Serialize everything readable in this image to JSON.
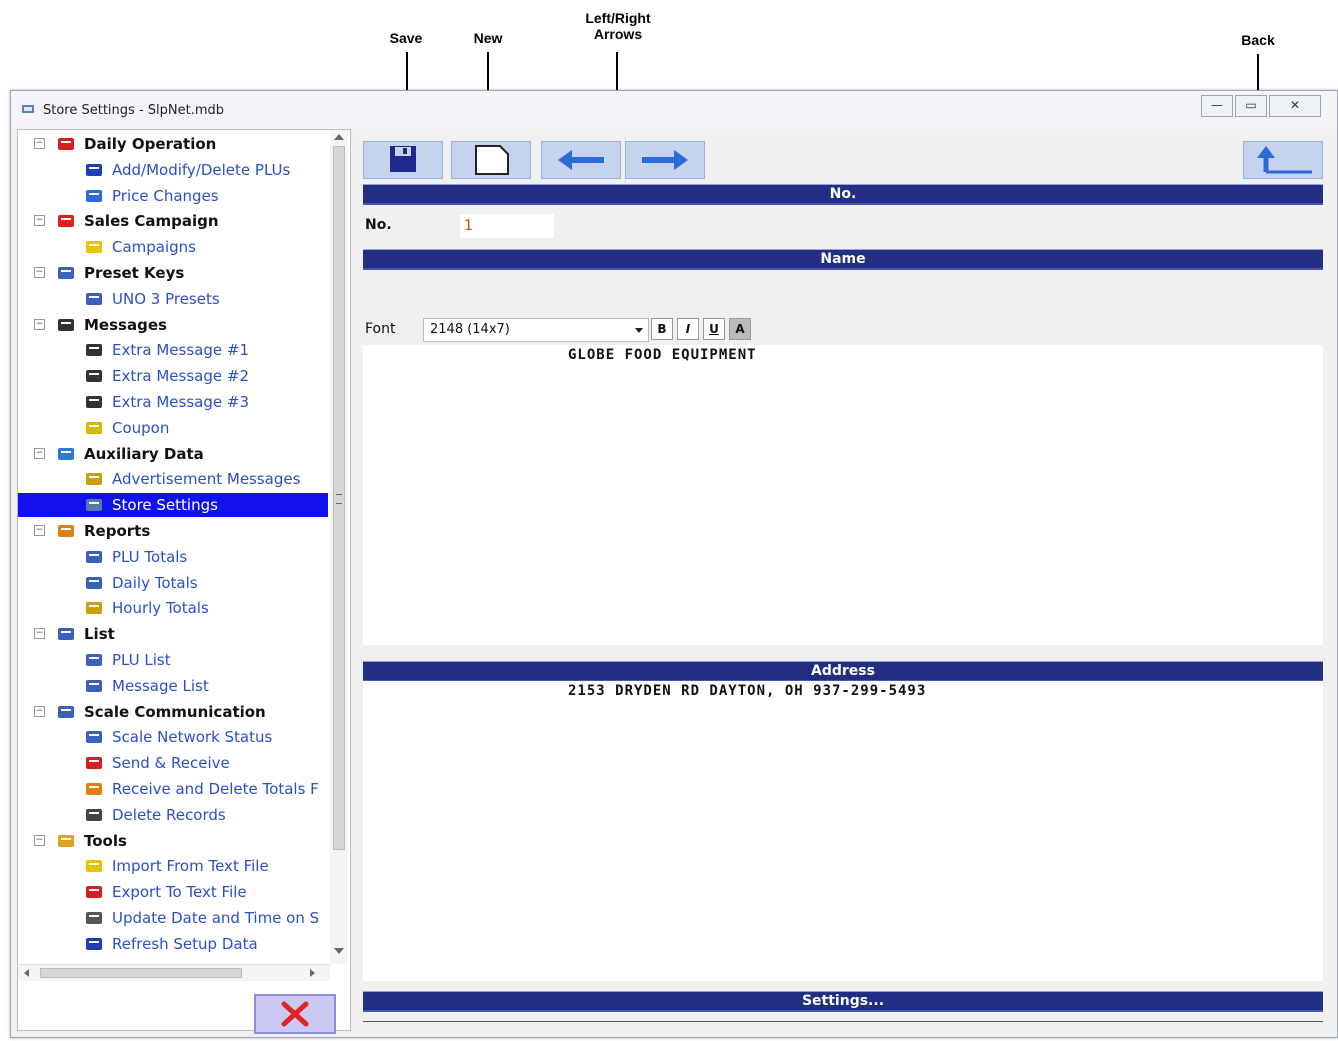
{
  "callouts": {
    "save": "Save",
    "new": "New",
    "arrows_line1": "Left/Right",
    "arrows_line2": "Arrows",
    "back": "Back"
  },
  "window": {
    "title": "Store Settings - SlpNet.mdb",
    "minimize": "—",
    "maximize": "▭",
    "close": "✕"
  },
  "tree": [
    {
      "type": "category",
      "label": "Daily Operation",
      "icon": "daily-operation-icon",
      "expander": "−"
    },
    {
      "type": "item",
      "label": "Add/Modify/Delete PLUs",
      "icon": "plu-icon"
    },
    {
      "type": "item",
      "label": "Price Changes",
      "icon": "price-changes-icon"
    },
    {
      "type": "category",
      "label": "Sales Campaign",
      "icon": "star-icon",
      "expander": "−"
    },
    {
      "type": "item",
      "label": "Campaigns",
      "icon": "campaign-star-icon"
    },
    {
      "type": "category",
      "label": "Preset Keys",
      "icon": "preset-keys-icon",
      "expander": "−"
    },
    {
      "type": "item",
      "label": "UNO 3 Presets",
      "icon": "presets-icon"
    },
    {
      "type": "category",
      "label": "Messages",
      "icon": "messages-icon",
      "expander": "−"
    },
    {
      "type": "item",
      "label": "Extra Message #1",
      "icon": "message-icon"
    },
    {
      "type": "item",
      "label": "Extra Message #2",
      "icon": "message-icon"
    },
    {
      "type": "item",
      "label": "Extra Message #3",
      "icon": "message-icon"
    },
    {
      "type": "item",
      "label": "Coupon",
      "icon": "coupon-icon"
    },
    {
      "type": "category",
      "label": "Auxiliary Data",
      "icon": "auxiliary-star-icon",
      "expander": "−"
    },
    {
      "type": "item",
      "label": "Advertisement Messages",
      "icon": "advertisement-icon"
    },
    {
      "type": "item",
      "label": "Store Settings",
      "icon": "store-icon",
      "selected": true
    },
    {
      "type": "category",
      "label": "Reports",
      "icon": "reports-icon",
      "expander": "−"
    },
    {
      "type": "item",
      "label": "PLU Totals",
      "icon": "chart-icon"
    },
    {
      "type": "item",
      "label": "Daily Totals",
      "icon": "daily-totals-icon"
    },
    {
      "type": "item",
      "label": "Hourly Totals",
      "icon": "hourly-totals-icon"
    },
    {
      "type": "category",
      "label": "List",
      "icon": "list-icon",
      "expander": "−"
    },
    {
      "type": "item",
      "label": "PLU List",
      "icon": "plu-list-icon"
    },
    {
      "type": "item",
      "label": "Message List",
      "icon": "message-list-icon"
    },
    {
      "type": "category",
      "label": "Scale Communication",
      "icon": "monitor-icon",
      "expander": "−"
    },
    {
      "type": "item",
      "label": "Scale Network Status",
      "icon": "network-icon"
    },
    {
      "type": "item",
      "label": "Send & Receive",
      "icon": "send-receive-icon"
    },
    {
      "type": "item",
      "label": "Receive and Delete Totals F",
      "icon": "receive-delete-icon"
    },
    {
      "type": "item",
      "label": "Delete Records",
      "icon": "delete-records-icon"
    },
    {
      "type": "category",
      "label": "Tools",
      "icon": "tools-icon",
      "expander": "−"
    },
    {
      "type": "item",
      "label": "Import From Text File",
      "icon": "import-icon"
    },
    {
      "type": "item",
      "label": "Export To Text File",
      "icon": "export-icon"
    },
    {
      "type": "item",
      "label": "Update Date and Time on S",
      "icon": "update-datetime-icon"
    },
    {
      "type": "item",
      "label": "Refresh Setup Data",
      "icon": "refresh-icon"
    }
  ],
  "sections": {
    "no_header": "No.",
    "name_header": "Name",
    "address_header": "Address",
    "settings_header": "Settings..."
  },
  "fields": {
    "no_label": "No.",
    "no_value": "1",
    "font_label": "Font",
    "font_value": "2148 (14x7)",
    "bold": "B",
    "italic": "I",
    "underline": "U",
    "invert": "A"
  },
  "content": {
    "name_text": "GLOBE FOOD EQUIPMENT",
    "address_text": "2153 DRYDEN RD  DAYTON, OH 937-299-5493"
  },
  "colors": {
    "header_bar": "#222e82",
    "selected_bg": "#1111ee",
    "toolbar_button": "#c5d3ef",
    "link_text": "#2a4fc9"
  }
}
